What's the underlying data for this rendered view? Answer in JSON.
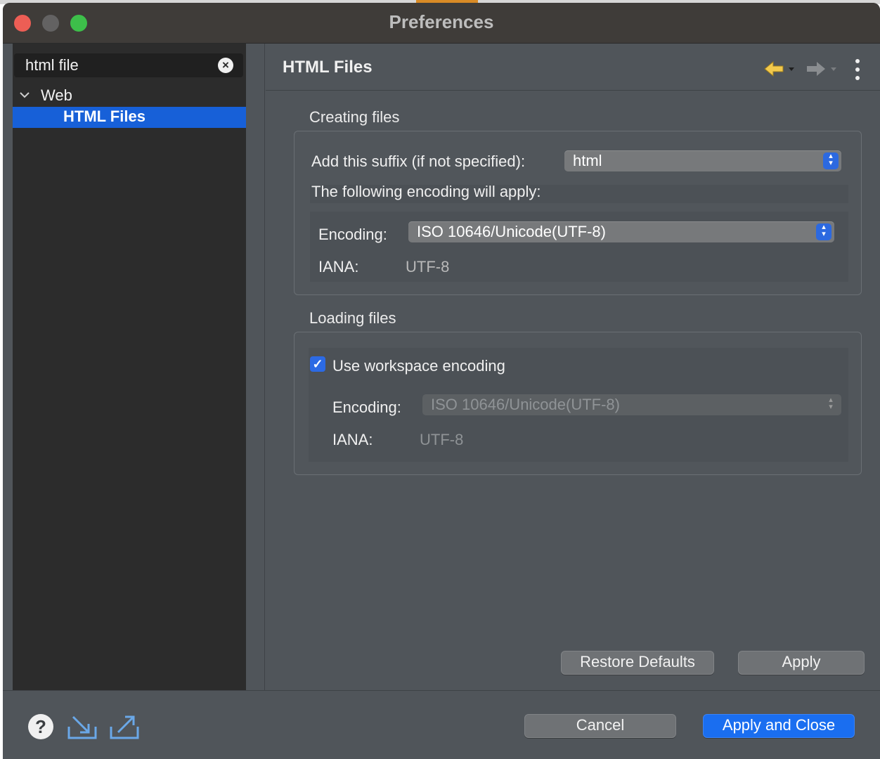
{
  "window": {
    "title": "Preferences"
  },
  "sidebar": {
    "search_value": "html file",
    "tree": [
      {
        "label": "Web",
        "expanded": true
      },
      {
        "label": "HTML Files",
        "selected": true
      }
    ]
  },
  "page": {
    "title": "HTML Files",
    "creating": {
      "heading": "Creating files",
      "suffix_label": "Add this suffix (if not specified):",
      "suffix_value": "html",
      "encoding_note": "The following encoding will apply:",
      "encoding_label": "Encoding:",
      "encoding_value": "ISO 10646/Unicode(UTF-8)",
      "iana_label": "IANA:",
      "iana_value": "UTF-8"
    },
    "loading": {
      "heading": "Loading files",
      "use_workspace_label": "Use workspace encoding",
      "use_workspace_checked": true,
      "encoding_label": "Encoding:",
      "encoding_value": "ISO 10646/Unicode(UTF-8)",
      "iana_label": "IANA:",
      "iana_value": "UTF-8"
    },
    "buttons": {
      "restore": "Restore Defaults",
      "apply": "Apply"
    }
  },
  "footer": {
    "cancel": "Cancel",
    "apply_close": "Apply and Close"
  },
  "colors": {
    "accent": "#1a6ef0",
    "selection": "#1760d8",
    "back_arrow": "#f2c94c"
  },
  "icons": [
    "help-icon",
    "import-icon",
    "export-icon",
    "back-arrow-icon",
    "forward-arrow-icon",
    "kebab-menu-icon",
    "clear-search-icon",
    "chevron-down-icon"
  ]
}
